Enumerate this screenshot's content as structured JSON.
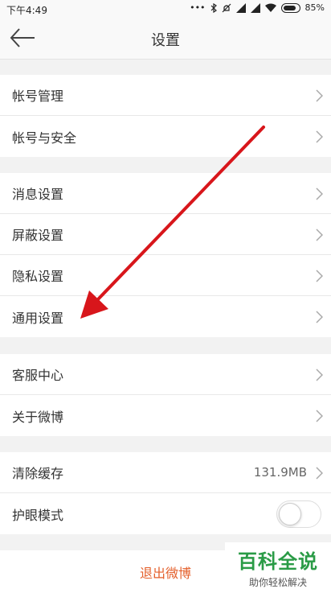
{
  "status_bar": {
    "time": "下午4:49",
    "battery_percent": "85%",
    "battery_level": 0.85,
    "icons": [
      "dots-icon",
      "bluetooth-icon",
      "mute-icon",
      "signal-icon",
      "signal-icon",
      "wifi-icon",
      "battery-icon"
    ]
  },
  "header": {
    "title": "设置"
  },
  "groups": [
    {
      "items": [
        {
          "label": "帐号管理"
        },
        {
          "label": "帐号与安全"
        }
      ]
    },
    {
      "items": [
        {
          "label": "消息设置"
        },
        {
          "label": "屏蔽设置"
        },
        {
          "label": "隐私设置"
        },
        {
          "label": "通用设置"
        }
      ]
    },
    {
      "items": [
        {
          "label": "客服中心"
        },
        {
          "label": "关于微博"
        }
      ]
    },
    {
      "items": [
        {
          "label": "清除缓存",
          "value": "131.9MB"
        },
        {
          "label": "护眼模式",
          "toggle_on": false
        }
      ]
    }
  ],
  "logout": {
    "label": "退出微博"
  },
  "watermark": {
    "title": "百科全说",
    "subtitle": "助你轻松解决"
  },
  "colors": {
    "accent": "#e4602c",
    "arrow": "#d8161b",
    "watermark": "#2a9b46"
  }
}
